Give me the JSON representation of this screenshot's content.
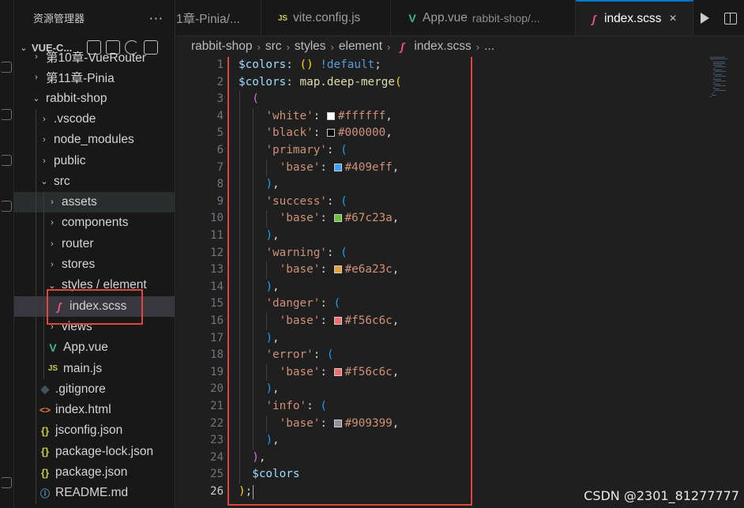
{
  "explorer": {
    "title": "资源管理器",
    "more": "···",
    "project": "VUE-C...",
    "items": [
      {
        "label": "第10章-VueRouter",
        "indent": 1,
        "chevron": "›",
        "icon": ""
      },
      {
        "label": "第11章-Pinia",
        "indent": 1,
        "chevron": "›",
        "icon": ""
      },
      {
        "label": "rabbit-shop",
        "indent": 1,
        "chevron": "⌄",
        "icon": ""
      },
      {
        "label": ".vscode",
        "indent": 2,
        "chevron": "›",
        "icon": ""
      },
      {
        "label": "node_modules",
        "indent": 2,
        "chevron": "›",
        "icon": ""
      },
      {
        "label": "public",
        "indent": 2,
        "chevron": "›",
        "icon": ""
      },
      {
        "label": "src",
        "indent": 2,
        "chevron": "⌄",
        "icon": ""
      },
      {
        "label": "assets",
        "indent": 3,
        "chevron": "›",
        "icon": ""
      },
      {
        "label": "components",
        "indent": 3,
        "chevron": "›",
        "icon": ""
      },
      {
        "label": "router",
        "indent": 3,
        "chevron": "›",
        "icon": ""
      },
      {
        "label": "stores",
        "indent": 3,
        "chevron": "›",
        "icon": ""
      },
      {
        "label": "styles / element",
        "indent": 3,
        "chevron": "⌄",
        "icon": ""
      },
      {
        "label": "index.scss",
        "indent": 4,
        "chevron": "",
        "icon": "scss"
      },
      {
        "label": "views",
        "indent": 3,
        "chevron": "›",
        "icon": ""
      },
      {
        "label": "App.vue",
        "indent": 3,
        "chevron": "",
        "icon": "vue"
      },
      {
        "label": "main.js",
        "indent": 3,
        "chevron": "",
        "icon": "js"
      },
      {
        "label": ".gitignore",
        "indent": 2,
        "chevron": "",
        "icon": "git"
      },
      {
        "label": "index.html",
        "indent": 2,
        "chevron": "",
        "icon": "html"
      },
      {
        "label": "jsconfig.json",
        "indent": 2,
        "chevron": "",
        "icon": "json"
      },
      {
        "label": "package-lock.json",
        "indent": 2,
        "chevron": "",
        "icon": "json"
      },
      {
        "label": "package.json",
        "indent": 2,
        "chevron": "",
        "icon": "json"
      },
      {
        "label": "README.md",
        "indent": 2,
        "chevron": "",
        "icon": "md"
      }
    ]
  },
  "tabs": [
    {
      "label": "1章-Pinia/...",
      "sub": "",
      "icon": ""
    },
    {
      "label": "vite.config.js",
      "sub": "",
      "icon": "js"
    },
    {
      "label": "App.vue",
      "sub": "rabbit-shop/...",
      "icon": "vue"
    },
    {
      "label": "index.scss",
      "sub": "",
      "icon": "scss",
      "active": true
    }
  ],
  "tab_close": "×",
  "breadcrumb": [
    "rabbit-shop",
    "src",
    "styles",
    "element",
    "index.scss",
    "..."
  ],
  "editor": {
    "current_line": 26,
    "lines": [
      "$colors: () !default;",
      "$colors: map.deep-merge(",
      "  (",
      "    'white': #ffffff,",
      "    'black': #000000,",
      "    'primary': (",
      "      'base': #409eff,",
      "    ),",
      "    'success': (",
      "      'base': #67c23a,",
      "    ),",
      "    'warning': (",
      "      'base': #e6a23c,",
      "    ),",
      "    'danger': (",
      "      'base': #f56c6c,",
      "    ),",
      "    'error': (",
      "      'base': #f56c6c,",
      "    ),",
      "    'info': (",
      "      'base': #909399,",
      "    ),",
      "  ),",
      "  $colors",
      ");"
    ]
  },
  "watermark": "CSDN @2301_81277777",
  "colors": {
    "highlight_box": "#e0443e",
    "active_tab_accent": "#0078d4"
  }
}
